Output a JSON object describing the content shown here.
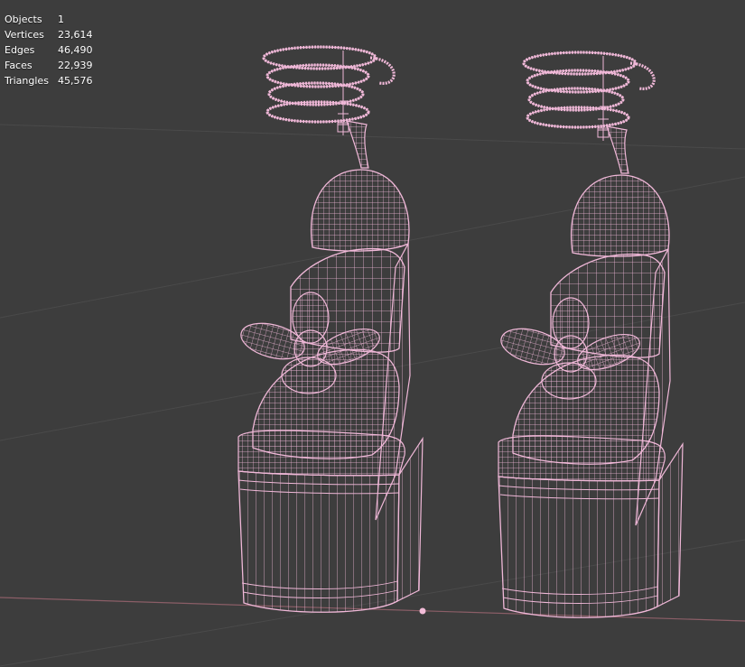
{
  "viewport": {
    "background_color": "#3d3d3d",
    "grid_line_color": "#4a4a4a",
    "x_axis_color": "#8b5e67",
    "wireframe_color": "#f0b8d8",
    "origin_point_color": "#f3bcd8"
  },
  "statistics": [
    {
      "label": "Objects",
      "value": "1"
    },
    {
      "label": "Vertices",
      "value": "23,614"
    },
    {
      "label": "Edges",
      "value": "46,490"
    },
    {
      "label": "Faces",
      "value": "22,939"
    },
    {
      "label": "Triangles",
      "value": "45,576"
    }
  ]
}
